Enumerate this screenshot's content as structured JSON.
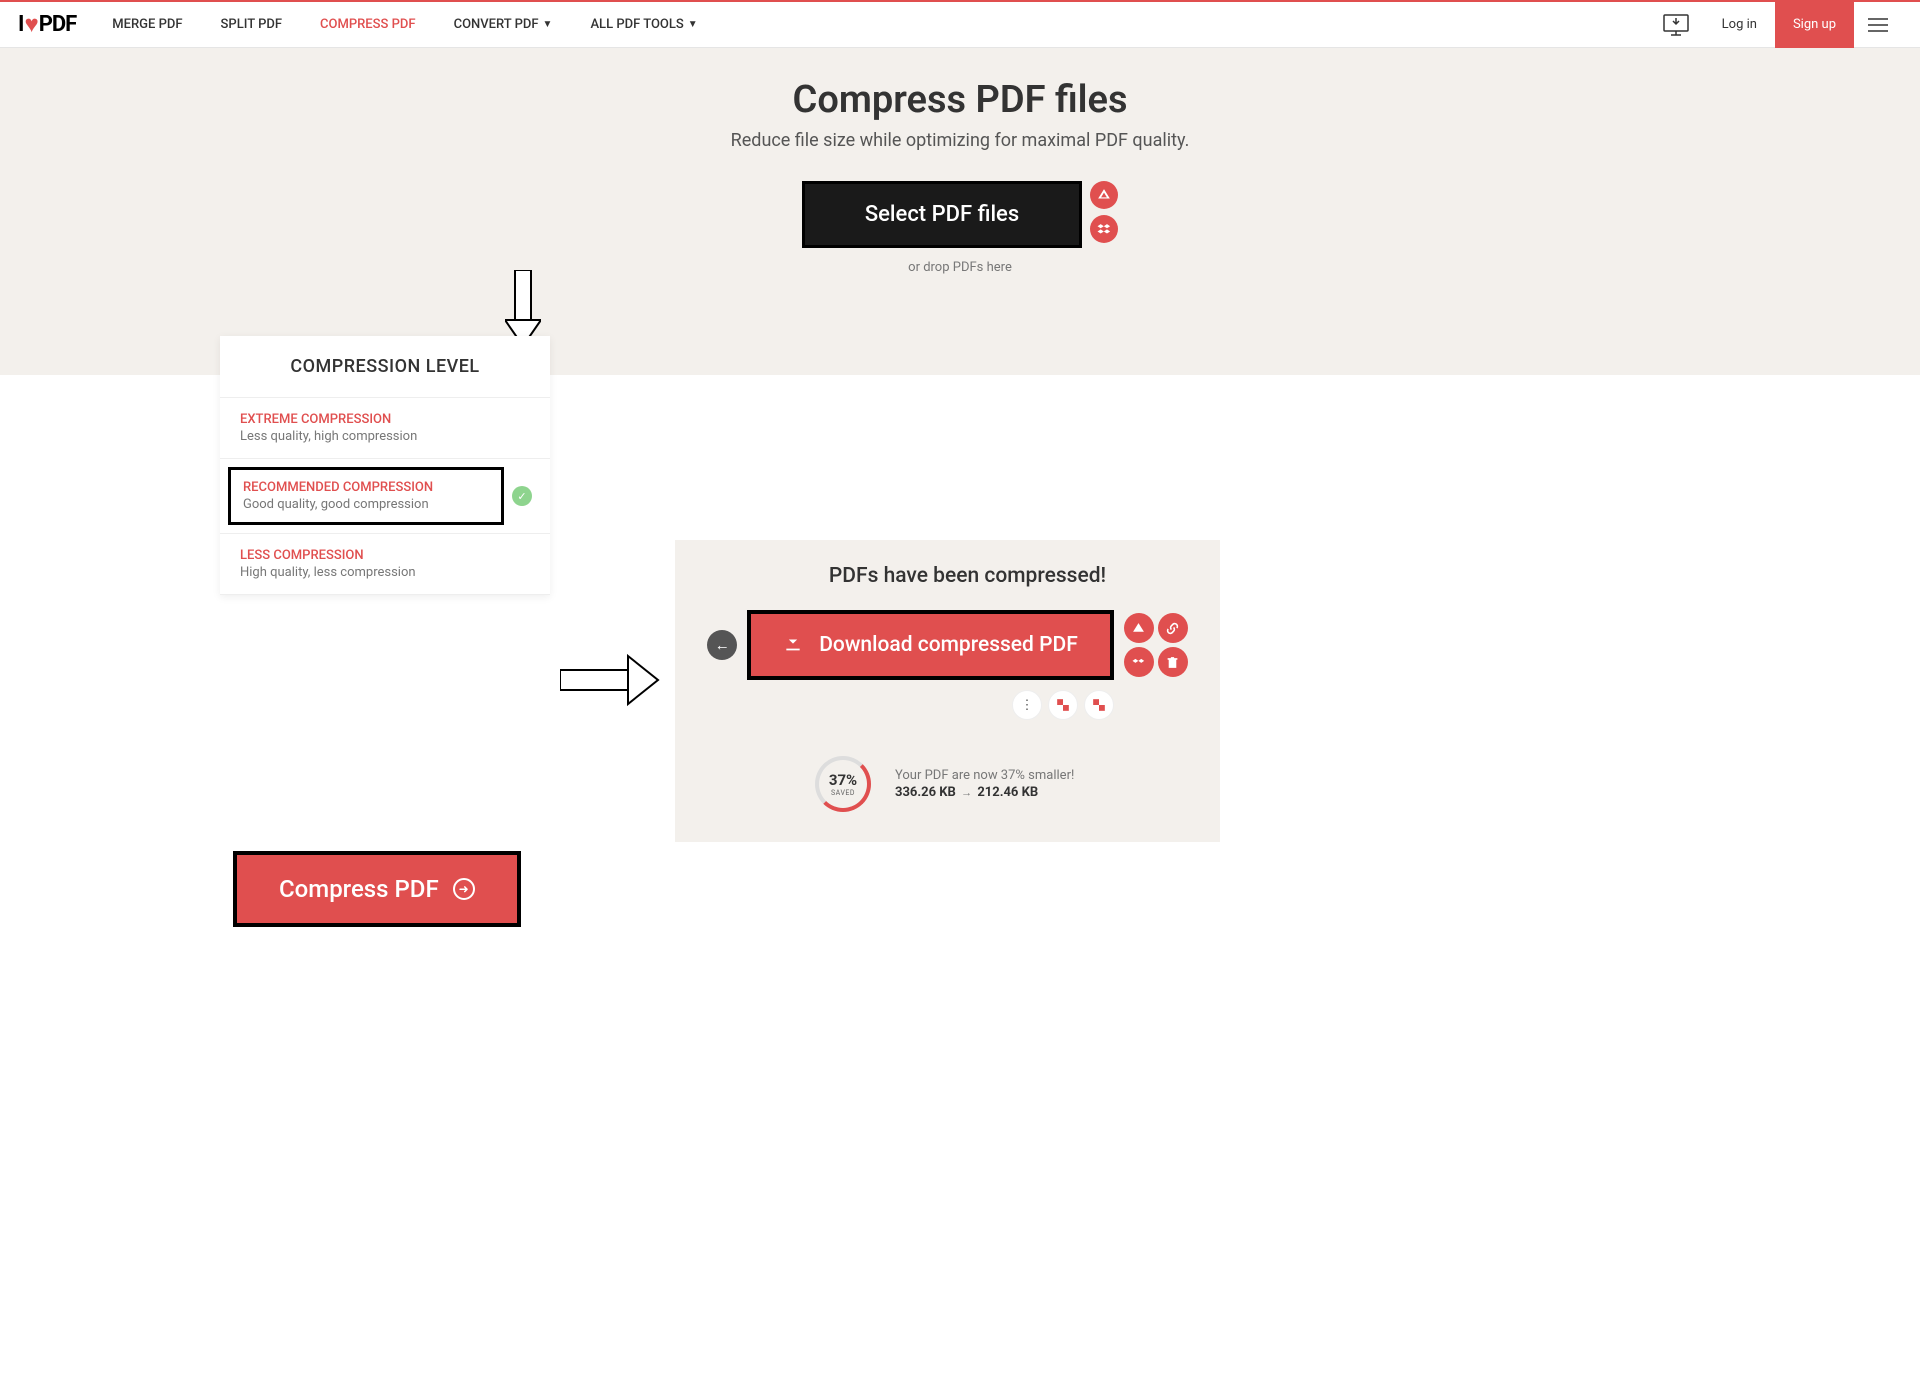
{
  "brand": {
    "prefix": "I",
    "suffix": "PDF"
  },
  "nav": {
    "merge": "MERGE PDF",
    "split": "SPLIT PDF",
    "compress": "COMPRESS PDF",
    "convert": "CONVERT PDF",
    "all": "ALL PDF TOOLS"
  },
  "auth": {
    "login": "Log in",
    "signup": "Sign up"
  },
  "hero": {
    "title": "Compress PDF files",
    "subtitle": "Reduce file size while optimizing for maximal PDF quality.",
    "select_btn": "Select PDF files",
    "drop_text": "or drop PDFs here"
  },
  "compression": {
    "header": "COMPRESSION LEVEL",
    "extreme": {
      "title": "EXTREME COMPRESSION",
      "sub": "Less quality, high compression"
    },
    "recommended": {
      "title": "RECOMMENDED COMPRESSION",
      "sub": "Good quality, good compression"
    },
    "less": {
      "title": "LESS COMPRESSION",
      "sub": "High quality, less compression"
    }
  },
  "compress_btn": "Compress PDF",
  "result": {
    "title": "PDFs have been compressed!",
    "download": "Download compressed PDF",
    "pct": "37%",
    "saved_label": "SAVED",
    "smaller_text": "Your PDF are now 37% smaller!",
    "size_before": "336.26 KB",
    "size_after": "212.46 KB"
  }
}
